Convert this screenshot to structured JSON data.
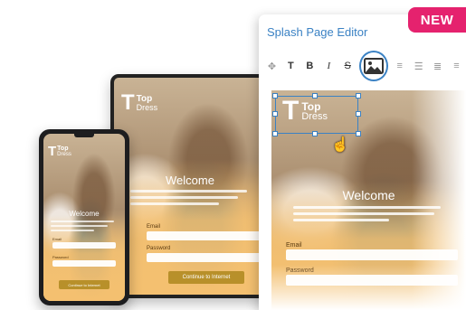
{
  "brand": {
    "logo_letter": "T",
    "logo_line1": "Top",
    "logo_line2": "Dress"
  },
  "splash": {
    "welcome": "Welcome",
    "email_label": "Email",
    "password_label": "Password",
    "continue_button": "Continue to Internet"
  },
  "editor": {
    "title": "Splash Page Editor",
    "badge": "NEW",
    "toolbar": [
      {
        "glyph": "✥",
        "name": "move-icon"
      },
      {
        "glyph": "T",
        "name": "text-size-icon"
      },
      {
        "glyph": "B",
        "name": "bold-icon"
      },
      {
        "glyph": "I",
        "name": "italic-icon"
      },
      {
        "glyph": "S",
        "name": "strikethrough-icon"
      },
      {
        "glyph": "",
        "name": "image-icon"
      },
      {
        "glyph": "≡",
        "name": "align-icon"
      },
      {
        "glyph": "☰",
        "name": "list-icon"
      },
      {
        "glyph": "≣",
        "name": "indent-icon"
      },
      {
        "glyph": "≡",
        "name": "more-format-icon"
      }
    ]
  },
  "colors": {
    "accent": "#3b82c4",
    "badge": "#e5226e",
    "button": "#b8902a"
  }
}
